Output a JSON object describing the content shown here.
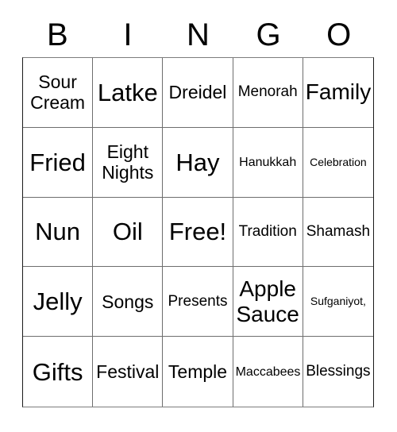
{
  "card": {
    "title_letters": [
      "B",
      "I",
      "N",
      "G",
      "O"
    ],
    "grid_size": "5x5",
    "free_space_label": "Free!",
    "colors": {
      "background": "#ffffff",
      "text": "#000000",
      "grid_line": "#6e6e6e",
      "grid_border": "#1a1a1a"
    }
  },
  "rows": [
    [
      {
        "text": "Sour\nCream",
        "size": "s-md"
      },
      {
        "text": "Latke",
        "size": "s-xl"
      },
      {
        "text": "Dreidel",
        "size": "s-md"
      },
      {
        "text": "Menorah",
        "size": "s-sm"
      },
      {
        "text": "Family",
        "size": "s-lg"
      }
    ],
    [
      {
        "text": "Fried",
        "size": "s-xl"
      },
      {
        "text": "Eight\nNights",
        "size": "s-md"
      },
      {
        "text": "Hay",
        "size": "s-xl"
      },
      {
        "text": "Hanukkah",
        "size": "s-xs"
      },
      {
        "text": "Celebration",
        "size": "s-xxs"
      }
    ],
    [
      {
        "text": "Nun",
        "size": "s-xl"
      },
      {
        "text": "Oil",
        "size": "s-xl"
      },
      {
        "text": "Free!",
        "size": "s-xl"
      },
      {
        "text": "Tradition",
        "size": "s-sm"
      },
      {
        "text": "Shamash",
        "size": "s-sm"
      }
    ],
    [
      {
        "text": "Jelly",
        "size": "s-xl"
      },
      {
        "text": "Songs",
        "size": "s-md"
      },
      {
        "text": "Presents",
        "size": "s-sm"
      },
      {
        "text": "Apple\nSauce",
        "size": "s-lg"
      },
      {
        "text": "Sufganiyot,",
        "size": "s-xxs"
      }
    ],
    [
      {
        "text": "Gifts",
        "size": "s-xl"
      },
      {
        "text": "Festival",
        "size": "s-md"
      },
      {
        "text": "Temple",
        "size": "s-md"
      },
      {
        "text": "Maccabees",
        "size": "s-xs"
      },
      {
        "text": "Blessings",
        "size": "s-sm"
      }
    ]
  ]
}
